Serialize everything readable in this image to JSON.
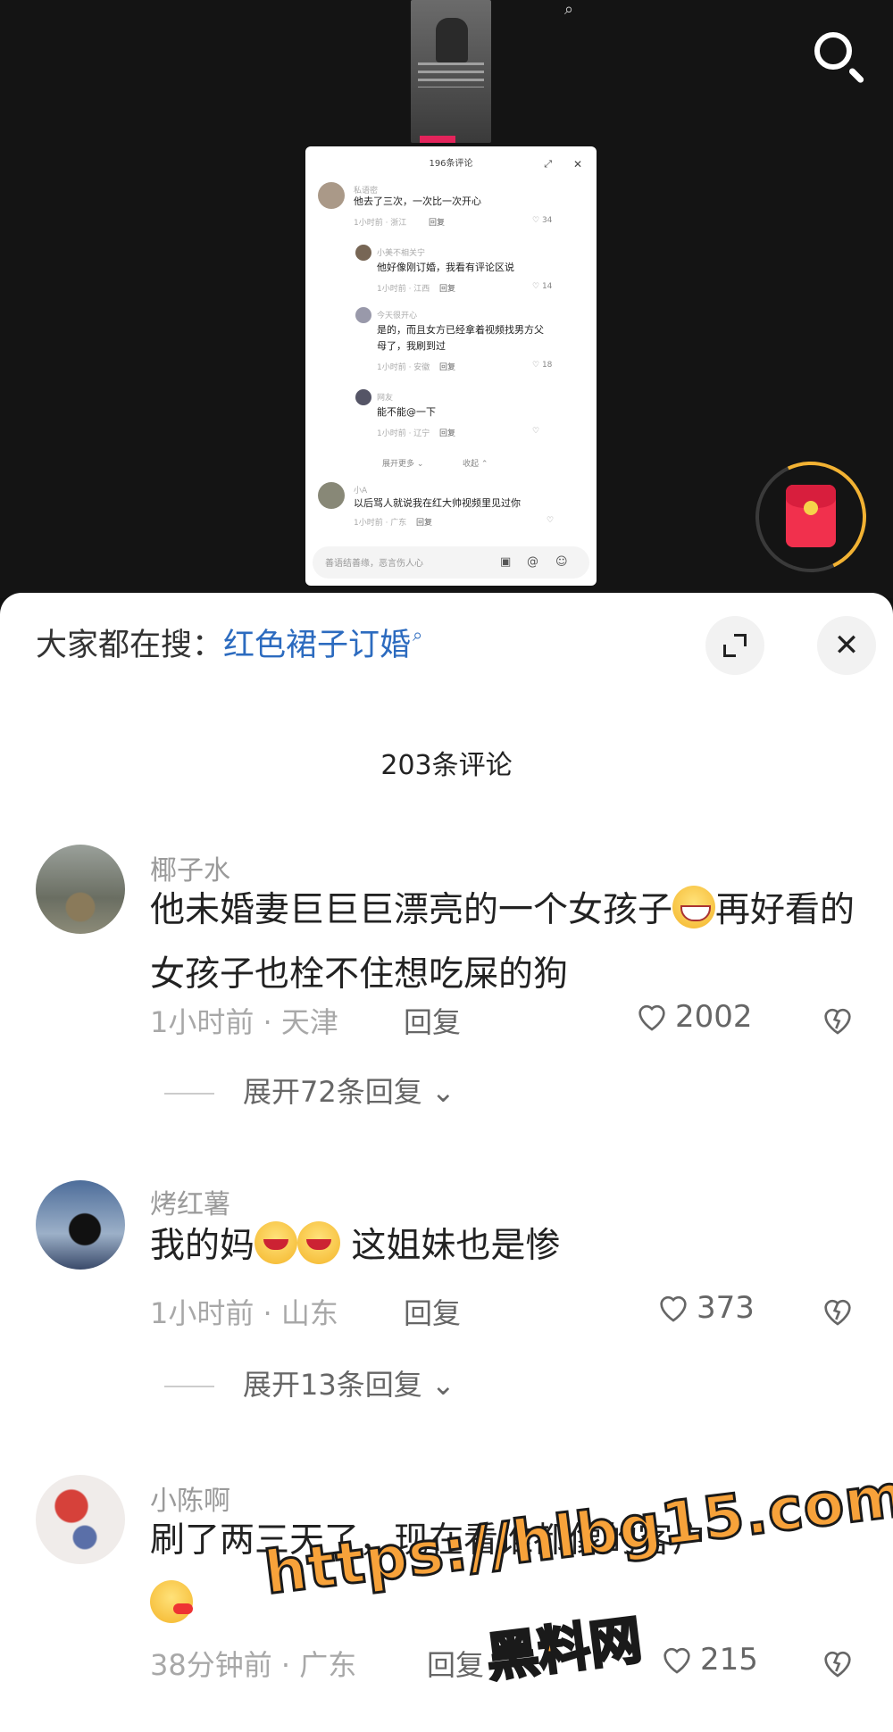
{
  "mini_card": {
    "title": "196条评论",
    "comments": [
      {
        "name": "私语密",
        "text": "他去了三次，一次比一次开心",
        "meta": "1小时前 · 浙江",
        "reply": "回复",
        "likes": "34"
      },
      {
        "name": "小美不相关宁",
        "text": "他好像刚订婚，我看有评论区说",
        "meta": "1小时前 · 江西",
        "reply": "回复",
        "likes": "14"
      },
      {
        "name": "今天很开心",
        "text": "是的，而且女方已经拿着视频找男方父",
        "text2": "母了，我刷到过",
        "meta": "1小时前 · 安徽",
        "reply": "回复",
        "likes": "18"
      },
      {
        "name": "网友",
        "text": "能不能@一下",
        "meta": "1小时前 · 辽宁",
        "reply": "回复",
        "likes": ""
      },
      {
        "name": "小A",
        "text": "以后骂人就说我在红大帅视频里见过你",
        "meta": "1小时前 · 广东",
        "reply": "回复",
        "likes": ""
      }
    ],
    "more_label": "展开更多",
    "collapse_label": "收起",
    "input_placeholder": "善语结善缘，恶言伤人心"
  },
  "header": {
    "search_prefix": "大家都在搜：",
    "search_term": "红色裙子订婚",
    "search_icon": "search-icon",
    "expand_icon": "expand-icon",
    "close_icon": "close-icon"
  },
  "comment_count": "203条评论",
  "comments": [
    {
      "name": "椰子水",
      "text_a": "他未婚妻巨巨巨漂亮的一个女孩子",
      "text_b": "再好看的女孩子也栓不住想吃屎的狗",
      "time": "1小时前 · 天津",
      "reply": "回复",
      "likes": "2002",
      "expand": "展开72条回复"
    },
    {
      "name": "烤红薯",
      "text_a": "我的妈",
      "text_b": " 这姐妹也是惨",
      "time": "1小时前 · 山东",
      "reply": "回复",
      "likes": "373",
      "expand": "展开13条回复"
    },
    {
      "name": "小陈啊",
      "text_a": "刷了两三天了，现在看谁都像",
      "text_b": "的客户",
      "time": "38分钟前 · 广东",
      "reply": "回复",
      "likes": "215"
    }
  ],
  "watermark": {
    "url": "https://hlbg15.com",
    "name": "黑料网"
  },
  "colors": {
    "accent_link": "#2c6bbf",
    "red_packet": "#f1304d",
    "watermark": "#f7a23a"
  }
}
